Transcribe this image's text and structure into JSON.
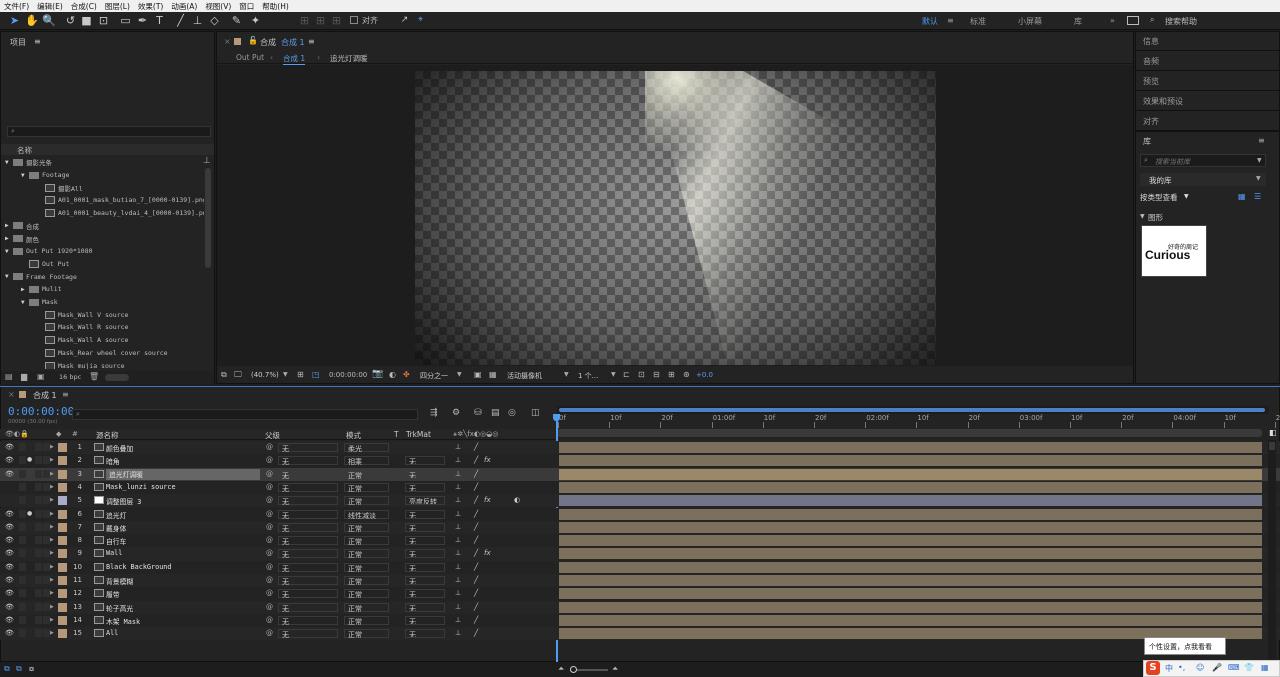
{
  "menu": [
    "文件(F)",
    "编辑(E)",
    "合成(C)",
    "图层(L)",
    "效果(T)",
    "动画(A)",
    "视图(V)",
    "窗口",
    "帮助(H)"
  ],
  "toolbar": {
    "align_label": "对齐",
    "workspaces": [
      "默认",
      "标准",
      "小屏幕",
      "库"
    ],
    "active_workspace": "默认",
    "search_placeholder": "搜索帮助"
  },
  "project": {
    "title": "项目",
    "col_name": "名称",
    "bpc": "16 bpc",
    "tree": [
      {
        "indent": 0,
        "open": true,
        "type": "folder",
        "label": "摄影光条"
      },
      {
        "indent": 1,
        "open": true,
        "type": "folder",
        "label": "Footage"
      },
      {
        "indent": 2,
        "open": null,
        "type": "footage",
        "label": "摄影All"
      },
      {
        "indent": 2,
        "open": null,
        "type": "footage",
        "label": "A01_0001_mask_butiao_7_[0000-0139].png"
      },
      {
        "indent": 2,
        "open": null,
        "type": "footage",
        "label": "A01_0001_beauty_lvdai_4_[0000-0139].pn"
      },
      {
        "indent": 0,
        "open": false,
        "type": "folder",
        "label": "合成"
      },
      {
        "indent": 0,
        "open": false,
        "type": "folder",
        "label": "颜色"
      },
      {
        "indent": 0,
        "open": true,
        "type": "folder",
        "label": "Out Put 1920*1080"
      },
      {
        "indent": 1,
        "open": null,
        "type": "footage",
        "label": "Out Put"
      },
      {
        "indent": 0,
        "open": true,
        "type": "folder",
        "label": "Frame Footage"
      },
      {
        "indent": 1,
        "open": false,
        "type": "folder",
        "label": "Mulit"
      },
      {
        "indent": 1,
        "open": true,
        "type": "folder",
        "label": "Mask"
      },
      {
        "indent": 2,
        "open": null,
        "type": "footage",
        "label": "Mask_Wall V source"
      },
      {
        "indent": 2,
        "open": null,
        "type": "footage",
        "label": "Mask_Wall R  source"
      },
      {
        "indent": 2,
        "open": null,
        "type": "footage",
        "label": "Mask_Wall A source"
      },
      {
        "indent": 2,
        "open": null,
        "type": "footage",
        "label": "Mask_Rear wheel cover source"
      },
      {
        "indent": 2,
        "open": null,
        "type": "footage",
        "label": "Mask_mujia source"
      }
    ]
  },
  "composition": {
    "panel_title": "合成",
    "comp_name": "合成 1",
    "breadcrumbs": [
      "Out Put",
      "合成 1",
      "追光灯调暖"
    ],
    "zoom": "(40.7%)",
    "timecode": "0:00:00:00",
    "resolution": "四分之一",
    "camera": "活动摄像机",
    "views": "1 个...",
    "exposure": "+0.0"
  },
  "right_panel": {
    "items": [
      "信息",
      "音频",
      "预览",
      "效果和预设",
      "对齐"
    ],
    "library_title": "库",
    "library_search": "搜索当前库",
    "my_library": "我的库",
    "view_by": "按类型查看",
    "section": "图形",
    "logo_top": "好奇的周记",
    "logo_main": "Curious"
  },
  "timeline": {
    "tab": "合成 1",
    "timecode": "0:00:00:00",
    "fps_note": "00000 (30.00 fps)",
    "headers": {
      "source": "源名称",
      "parent": "父级",
      "mode": "模式",
      "t": "T",
      "trkmat": "TrkMat"
    },
    "ruler": [
      "0f",
      "10f",
      "20f",
      "01:00f",
      "10f",
      "20f",
      "02:00f",
      "10f",
      "20f",
      "03:00f",
      "10f",
      "20f",
      "04:00f",
      "10f",
      "20f"
    ],
    "layers": [
      {
        "num": "1",
        "name": "颜色叠加",
        "parent": "无",
        "mode": "柔光",
        "trkmat": "",
        "fx": false,
        "color": "#b5997a",
        "icon": "footage",
        "eye": true,
        "solo": false
      },
      {
        "num": "2",
        "name": "暗角",
        "parent": "无",
        "mode": "相乘",
        "trkmat": "无",
        "fx": true,
        "color": "#b5997a",
        "icon": "footage",
        "eye": true,
        "solo": true
      },
      {
        "num": "3",
        "name": "追光灯调暖",
        "parent": "无",
        "mode": "正常",
        "trkmat": "无",
        "fx": false,
        "color": "#b5997a",
        "icon": "footage",
        "eye": true,
        "solo": false,
        "selected": true
      },
      {
        "num": "4",
        "name": "Mask_lunzi source",
        "parent": "无",
        "mode": "正常",
        "trkmat": "无",
        "fx": false,
        "color": "#b5997a",
        "icon": "comp",
        "eye": false,
        "solo": false
      },
      {
        "num": "5",
        "name": "调整图层 3",
        "parent": "无",
        "mode": "正常",
        "trkmat": "亮度反转",
        "fx": true,
        "color": "#a9abc7",
        "icon": "adjust",
        "eye": false,
        "solo": false,
        "adjust": true
      },
      {
        "num": "6",
        "name": "追光灯",
        "parent": "无",
        "mode": "线性减淡",
        "trkmat": "无",
        "fx": false,
        "color": "#b5997a",
        "icon": "footage",
        "eye": true,
        "solo": true
      },
      {
        "num": "7",
        "name": "戴身体",
        "parent": "无",
        "mode": "正常",
        "trkmat": "无",
        "fx": false,
        "color": "#b5997a",
        "icon": "footage",
        "eye": true,
        "solo": false
      },
      {
        "num": "8",
        "name": "自行车",
        "parent": "无",
        "mode": "正常",
        "trkmat": "无",
        "fx": false,
        "color": "#b5997a",
        "icon": "footage",
        "eye": true,
        "solo": false
      },
      {
        "num": "9",
        "name": "Wall",
        "parent": "无",
        "mode": "正常",
        "trkmat": "无",
        "fx": true,
        "color": "#b5997a",
        "icon": "footage",
        "eye": true,
        "solo": false
      },
      {
        "num": "10",
        "name": "Black BackGround",
        "parent": "无",
        "mode": "正常",
        "trkmat": "无",
        "fx": false,
        "color": "#b5997a",
        "icon": "footage",
        "eye": true,
        "solo": false
      },
      {
        "num": "11",
        "name": "背景模糊",
        "parent": "无",
        "mode": "正常",
        "trkmat": "无",
        "fx": false,
        "color": "#b5997a",
        "icon": "footage",
        "eye": true,
        "solo": false
      },
      {
        "num": "12",
        "name": "履带",
        "parent": "无",
        "mode": "正常",
        "trkmat": "无",
        "fx": false,
        "color": "#b5997a",
        "icon": "footage",
        "eye": true,
        "solo": false
      },
      {
        "num": "13",
        "name": "轮子高光",
        "parent": "无",
        "mode": "正常",
        "trkmat": "无",
        "fx": false,
        "color": "#b5997a",
        "icon": "footage",
        "eye": true,
        "solo": false
      },
      {
        "num": "14",
        "name": "木架 Mask",
        "parent": "无",
        "mode": "正常",
        "trkmat": "无",
        "fx": false,
        "color": "#b5997a",
        "icon": "footage",
        "eye": true,
        "solo": false
      },
      {
        "num": "15",
        "name": "All",
        "parent": "无",
        "mode": "正常",
        "trkmat": "无",
        "fx": false,
        "color": "#b5997a",
        "icon": "footage",
        "eye": true,
        "solo": false
      }
    ]
  },
  "tooltip": "个性设置，点我看看",
  "ime": {
    "lang": "中"
  }
}
